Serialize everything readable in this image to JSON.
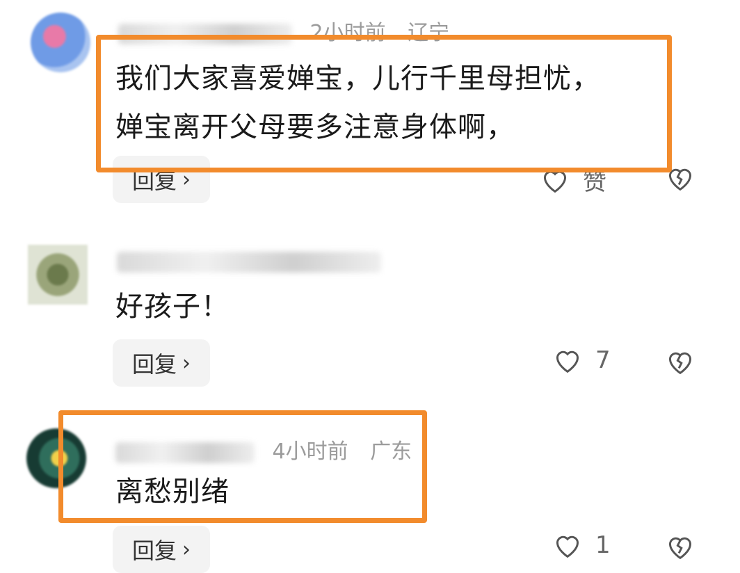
{
  "comments": [
    {
      "meta_time": "2小时前",
      "meta_region": "辽宁",
      "text_line1": "我们大家喜爱婵宝，儿行千里母担忧，",
      "text_line2": "婵宝离开父母要多注意身体啊，",
      "reply_label": "回复",
      "like_label": "赞"
    },
    {
      "meta_time": "",
      "meta_region": "",
      "text_line1": "好孩子！",
      "reply_label": "回复",
      "like_label": "7"
    },
    {
      "meta_time": "4小时前",
      "meta_region": "广东",
      "text_line1": "离愁别绪",
      "reply_label": "回复",
      "like_label": "1"
    }
  ],
  "icons": {
    "reply_chevron": "chevron-right-icon",
    "like": "heart-icon",
    "dislike": "broken-heart-icon"
  },
  "colors": {
    "highlight": "#f28b2c",
    "meta_text": "#9b9b9b",
    "reply_bg": "#f3f3f3"
  }
}
